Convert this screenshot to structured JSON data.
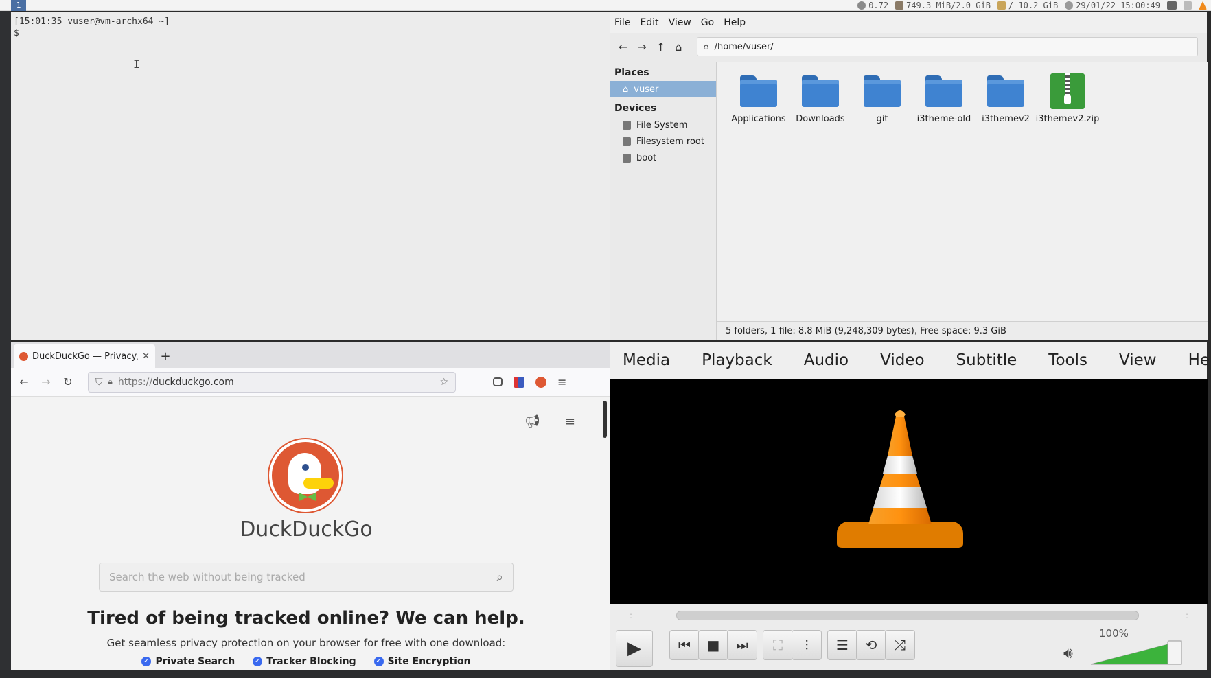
{
  "topbar": {
    "workspace": "1",
    "cpu": "0.72",
    "memory": "749.3 MiB/2.0 GiB",
    "disk": "/ 10.2 GiB",
    "datetime": "29/01/22 15:00:49"
  },
  "terminal": {
    "prompt_line": "[15:01:35 vuser@vm-archx64 ~]",
    "input_line": "$"
  },
  "file_manager": {
    "menu": [
      "File",
      "Edit",
      "View",
      "Go",
      "Help"
    ],
    "path": "/home/vuser/",
    "places_heading": "Places",
    "places": [
      "vuser"
    ],
    "devices_heading": "Devices",
    "devices": [
      "File System",
      "Filesystem root",
      "boot"
    ],
    "items": [
      {
        "name": "Applications",
        "type": "folder"
      },
      {
        "name": "Downloads",
        "type": "folder"
      },
      {
        "name": "git",
        "type": "folder"
      },
      {
        "name": "i3theme-old",
        "type": "folder"
      },
      {
        "name": "i3themev2",
        "type": "folder"
      },
      {
        "name": "i3themev2.zip",
        "type": "archive"
      }
    ],
    "status": "5 folders, 1 file: 8.8 MiB (9,248,309 bytes), Free space: 9.3 GiB"
  },
  "browser": {
    "tab_title": "DuckDuckGo — Privacy,",
    "url_prefix": "https://",
    "url_host": "duckduckgo.com",
    "brand": "DuckDuckGo",
    "search_placeholder": "Search the web without being tracked",
    "tagline": "Tired of being tracked online? We can help.",
    "subline": "Get seamless privacy protection on your browser for free with one download:",
    "features": [
      "Private Search",
      "Tracker Blocking",
      "Site Encryption"
    ]
  },
  "vlc": {
    "menu": [
      "Media",
      "Playback",
      "Audio",
      "Video",
      "Subtitle",
      "Tools",
      "View",
      "Help"
    ],
    "time_elapsed": "--:--",
    "time_total": "--:--",
    "volume": "100%",
    "volume_level": 1.0
  }
}
